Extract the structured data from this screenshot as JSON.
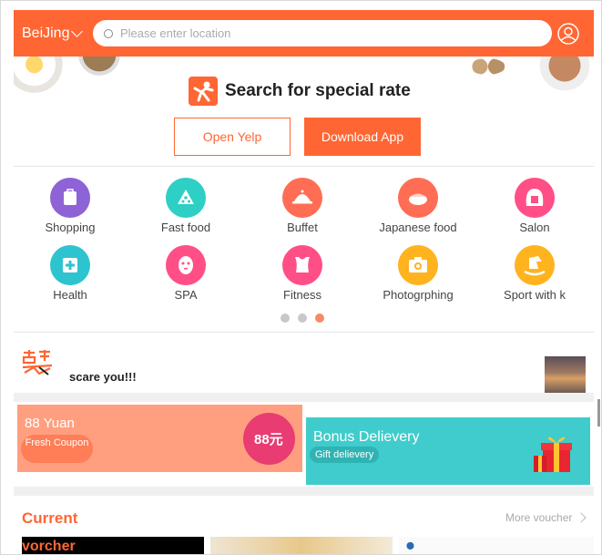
{
  "header": {
    "city": "BeiJing",
    "search_placeholder": "Please enter location"
  },
  "hero": {
    "title": "Search for special rate",
    "open_label": "Open Yelp",
    "download_label": "Download App"
  },
  "categories": [
    {
      "label": "Shopping",
      "color": "#8e63d6",
      "icon": "shopping-bag-icon"
    },
    {
      "label": "Fast food",
      "color": "#2ecfc5",
      "icon": "pizza-icon"
    },
    {
      "label": "Buffet",
      "color": "#ff6d55",
      "icon": "cloche-icon"
    },
    {
      "label": "Japanese food",
      "color": "#ff6d55",
      "icon": "sushi-icon"
    },
    {
      "label": "Salon",
      "color": "#ff4f86",
      "icon": "hair-icon"
    },
    {
      "label": "Health",
      "color": "#2ec4cf",
      "icon": "first-aid-icon"
    },
    {
      "label": "SPA",
      "color": "#ff4f86",
      "icon": "face-mask-icon"
    },
    {
      "label": "Fitness",
      "color": "#ff4f86",
      "icon": "fitness-icon"
    },
    {
      "label": "Photogrphing",
      "color": "#ffb31f",
      "icon": "camera-icon"
    },
    {
      "label": "Sport with k",
      "color": "#ffb31f",
      "icon": "rocking-horse-icon"
    }
  ],
  "carousel": {
    "pages": 3,
    "active": 3
  },
  "headline": {
    "text": "scare you!!!"
  },
  "promos": {
    "left": {
      "amount": "88 Yuan",
      "pill": "Fresh Coupon",
      "badge": "88元"
    },
    "right": {
      "title": "Bonus Delievery",
      "pill": "Gift delievery"
    }
  },
  "current": {
    "title": "Current",
    "more": "More voucher",
    "card1_text": "vorcher"
  },
  "colors": {
    "brand": "#ff6633",
    "promo_left": "#ff9f80",
    "promo_right": "#40cccc"
  }
}
